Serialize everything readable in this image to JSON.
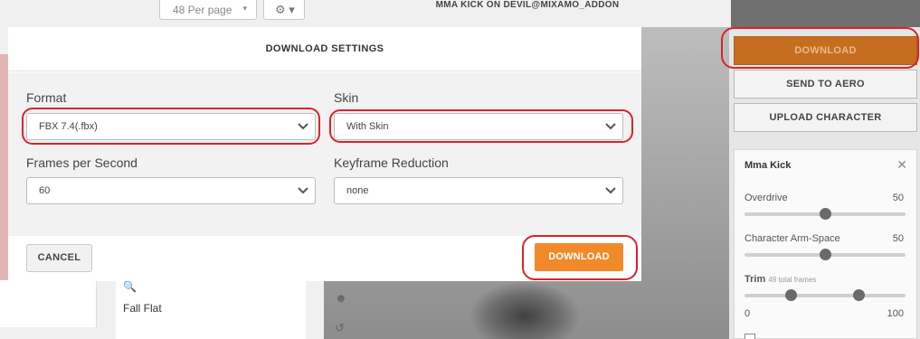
{
  "background": {
    "per_page": "48 Per page",
    "per_page_caret": "▾",
    "gear": "⚙ ▾",
    "card_label": "Fall Flat",
    "viewport_title": "MMA KICK ON DEVIL@MIXAMO_ADDON"
  },
  "right_panel": {
    "download_label": "DOWNLOAD",
    "send_to_aero_label": "SEND TO AERO",
    "upload_character_label": "UPLOAD CHARACTER",
    "animation": {
      "title": "Mma Kick",
      "close": "✕",
      "overdrive_label": "Overdrive",
      "overdrive_value": "50",
      "overdrive_fraction": 0.5,
      "arm_space_label": "Character Arm-Space",
      "arm_space_value": "50",
      "arm_space_fraction": 0.5,
      "trim_label": "Trim",
      "trim_frames": "49 total frames",
      "trim_min": "0",
      "trim_max": "100",
      "trim_start_fraction": 0.27,
      "trim_end_fraction": 0.73
    }
  },
  "modal": {
    "title": "DOWNLOAD SETTINGS",
    "format_label": "Format",
    "format_value": "FBX 7.4(.fbx)",
    "skin_label": "Skin",
    "skin_value": "With Skin",
    "fps_label": "Frames per Second",
    "fps_value": "60",
    "keyframe_label": "Keyframe Reduction",
    "keyframe_value": "none",
    "cancel_label": "CANCEL",
    "download_label": "DOWNLOAD"
  },
  "colors": {
    "accent": "#f28a2a",
    "highlight": "#d9232c"
  }
}
